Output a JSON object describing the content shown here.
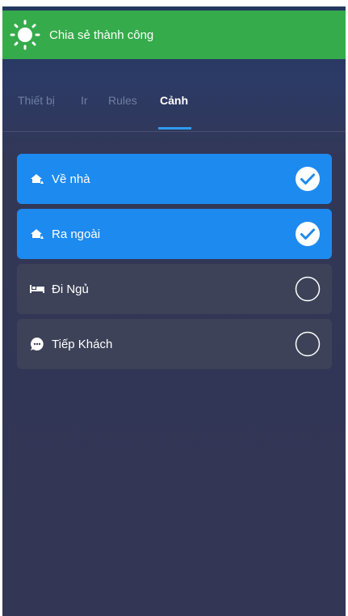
{
  "toast": {
    "message": "Chia sẻ thành công",
    "icon": "sun-icon",
    "color": "#35ab4b"
  },
  "tabs": [
    {
      "label": "Thiết bị",
      "active": false
    },
    {
      "label": "Ir",
      "active": false
    },
    {
      "label": "Rules",
      "active": false
    },
    {
      "label": "Cảnh",
      "active": true
    }
  ],
  "scenes": [
    {
      "label": "Về nhà",
      "icon": "home-user-icon",
      "selected": true
    },
    {
      "label": "Ra ngoài",
      "icon": "home-user-icon",
      "selected": true
    },
    {
      "label": "Đi Ngủ",
      "icon": "bed-icon",
      "selected": false
    },
    {
      "label": "Tiếp Khách",
      "icon": "chat-bubble-icon",
      "selected": false
    }
  ],
  "colors": {
    "accent": "#1d8af0",
    "unselected_row": "#3d4258",
    "background": "#333655"
  }
}
